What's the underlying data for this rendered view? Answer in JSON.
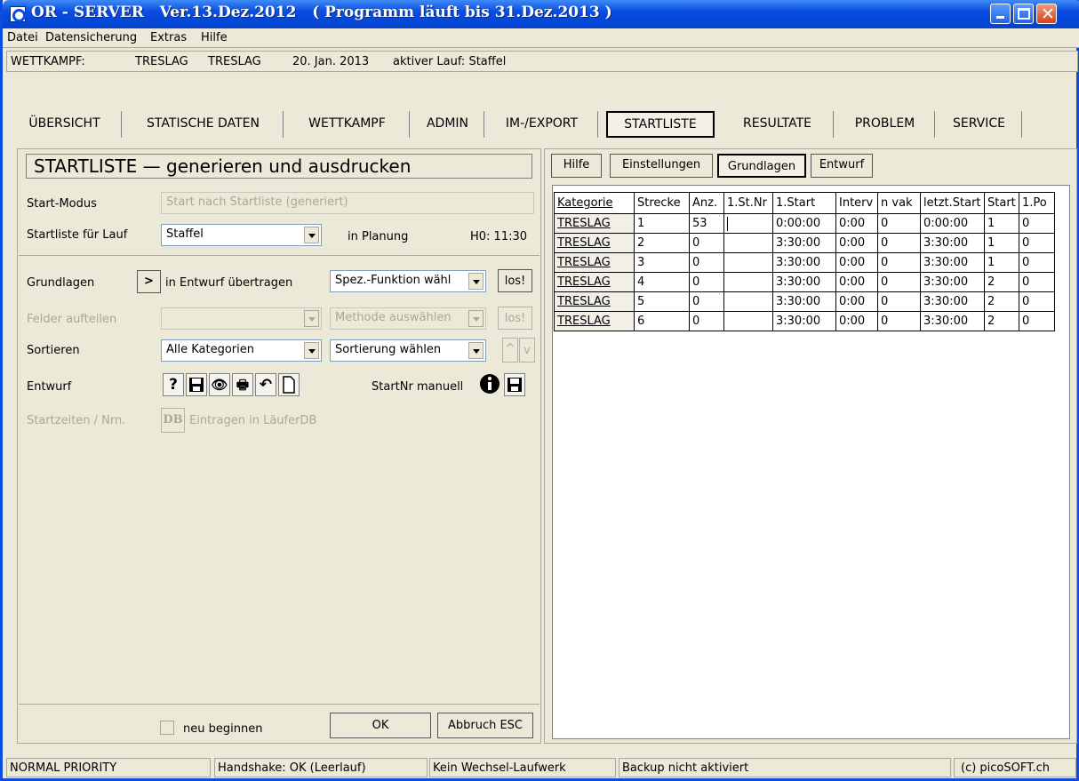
{
  "title": {
    "app": "OR - SERVER",
    "version": "Ver.13.Dez.2012",
    "license": "( Programm läuft bis 31.Dez.2013 )"
  },
  "menu": [
    "Datei",
    "Datensicherung",
    "Extras",
    "Hilfe"
  ],
  "info": {
    "label": "WETTKAMPF:",
    "name1": "TRESLAG",
    "name2": "TRESLAG",
    "date": "20. Jan. 2013",
    "active": "aktiver Lauf: Staffel"
  },
  "tabs": [
    "ÜBERSICHT",
    "STATISCHE DATEN",
    "WETTKAMPF",
    "ADMIN",
    "IM-/EXPORT",
    "STARTLISTE",
    "RESULTATE",
    "PROBLEM",
    "SERVICE"
  ],
  "active_tab": "STARTLISTE",
  "left": {
    "heading": "STARTLISTE — generieren und ausdrucken",
    "start_modus_label": "Start-Modus",
    "start_modus_value": "Start nach Startliste (generiert)",
    "lauf_label": "Startliste für Lauf",
    "lauf_value": "Staffel",
    "planung": "in Planung",
    "h0": "H0: 11:30",
    "grundlagen_label": "Grundlagen",
    "transfer_btn": ">",
    "transfer_text": "in Entwurf übertragen",
    "spez_value": "Spez.-Funktion wähl",
    "los1": "los!",
    "felder_label": "Felder aufteilen",
    "methode_value": "Methode auswählen",
    "los2": "los!",
    "sortieren_label": "Sortieren",
    "kategorien_value": "Alle Kategorien",
    "sortierung_value": "Sortierung wählen",
    "up": "^",
    "down": "v",
    "entwurf_label": "Entwurf",
    "startnr_label": "StartNr manuell",
    "startzeiten_label": "Startzeiten / Nrn.",
    "db_btn": "DB",
    "db_text": "Eintragen in LäuferDB",
    "neu_label": "neu beginnen",
    "ok": "OK",
    "abbruch": "Abbruch ESC"
  },
  "right": {
    "buttons": [
      "Hilfe",
      "Einstellungen",
      "Grundlagen",
      "Entwurf"
    ],
    "active_button": "Grundlagen",
    "columns": [
      "Kategorie",
      "Strecke",
      "Anz.",
      "1.St.Nr",
      "1.Start",
      "Interv",
      "n vak",
      "letzt.Start",
      "Start",
      "1.Po"
    ],
    "rows": [
      [
        "TRESLAG",
        "1",
        "53",
        "",
        "0:00:00",
        "0:00",
        "0",
        "0:00:00",
        "1",
        "0"
      ],
      [
        "TRESLAG",
        "2",
        "0",
        "",
        "3:30:00",
        "0:00",
        "0",
        "3:30:00",
        "1",
        "0"
      ],
      [
        "TRESLAG",
        "3",
        "0",
        "",
        "3:30:00",
        "0:00",
        "0",
        "3:30:00",
        "1",
        "0"
      ],
      [
        "TRESLAG",
        "4",
        "0",
        "",
        "3:30:00",
        "0:00",
        "0",
        "3:30:00",
        "2",
        "0"
      ],
      [
        "TRESLAG",
        "5",
        "0",
        "",
        "3:30:00",
        "0:00",
        "0",
        "3:30:00",
        "2",
        "0"
      ],
      [
        "TRESLAG",
        "6",
        "0",
        "",
        "3:30:00",
        "0:00",
        "0",
        "3:30:00",
        "2",
        "0"
      ]
    ]
  },
  "status": [
    "NORMAL PRIORITY",
    "Handshake: OK (Leerlauf)",
    "Kein Wechsel-Laufwerk",
    "Backup nicht aktiviert",
    "(c) picoSOFT.ch"
  ]
}
